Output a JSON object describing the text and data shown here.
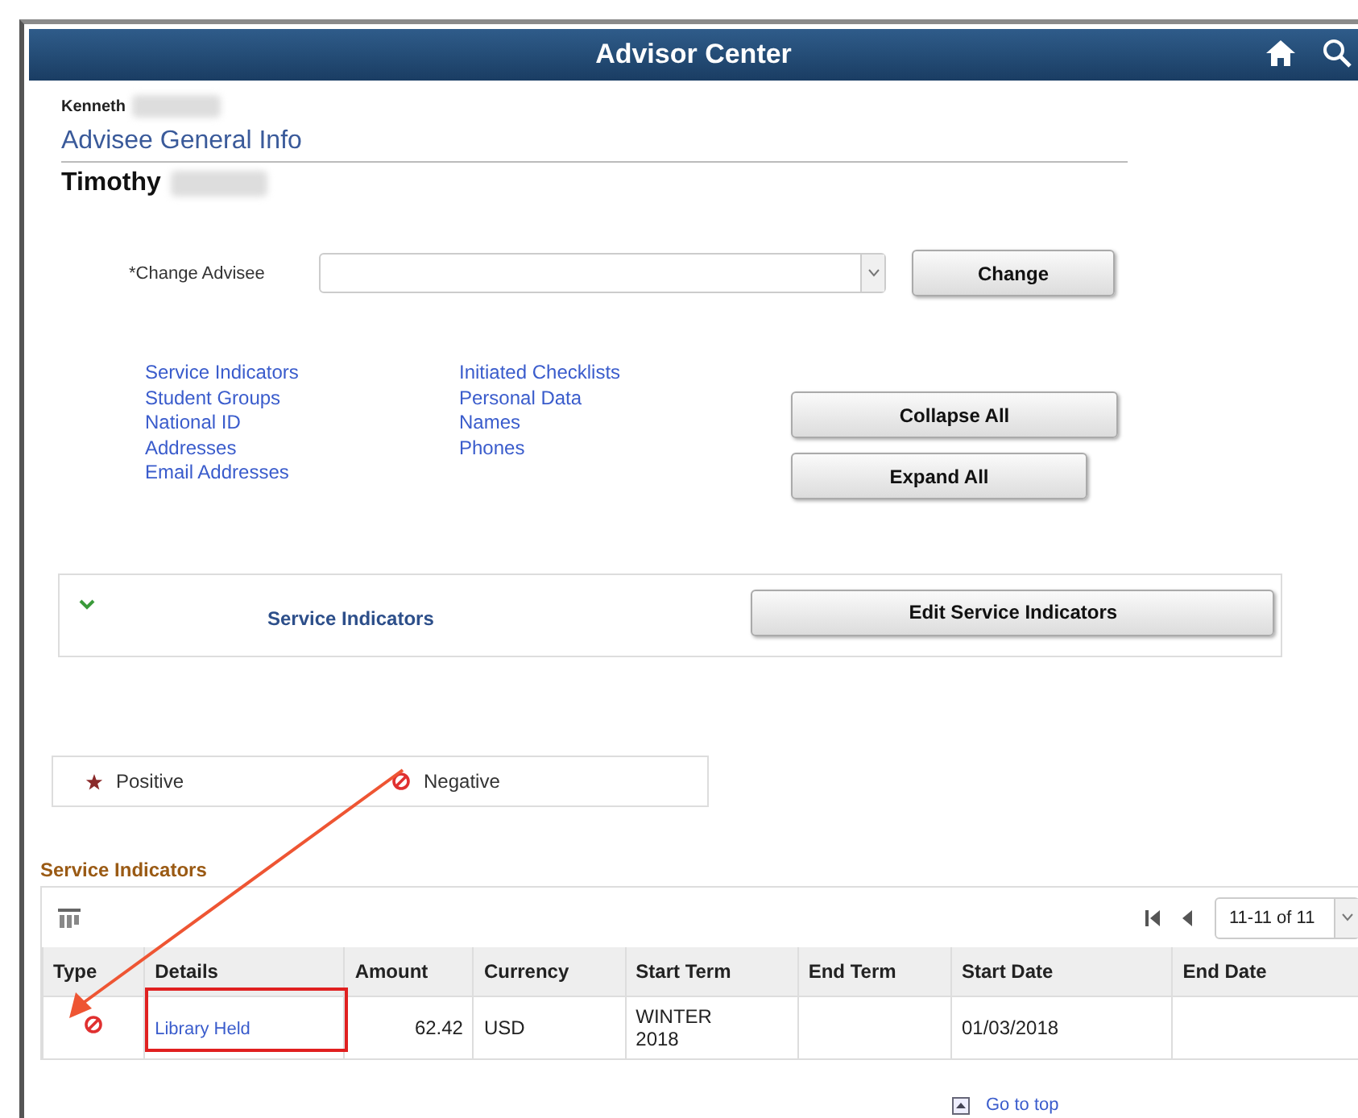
{
  "header": {
    "title": "Advisor Center"
  },
  "advisor": {
    "first_name": "Kenneth"
  },
  "section_title": "Advisee General Info",
  "advisee": {
    "first_name": "Timothy"
  },
  "change_advisee": {
    "label": "*Change Advisee",
    "button": "Change"
  },
  "quick_links": [
    [
      "Service Indicators",
      "Student Groups",
      "National ID",
      "Addresses",
      "Email Addresses"
    ],
    [
      "Initiated Checklists",
      "Personal Data",
      "Names",
      "Phones"
    ]
  ],
  "collapse_button": "Collapse All",
  "expand_button": "Expand All",
  "panel": {
    "title": "Service Indicators",
    "expanded": true,
    "button": "Edit Service Indicators"
  },
  "legend": [
    {
      "kind": "positive",
      "label": "Positive"
    },
    {
      "kind": "negative",
      "label": "Negative"
    }
  ],
  "grid": {
    "title": "Service Indicators",
    "pager": "11-11 of 11",
    "columns": [
      "Type",
      "Details",
      "Amount",
      "Currency",
      "Start Term",
      "End Term",
      "Start Date",
      "End Date"
    ],
    "rows": [
      {
        "kind": "negative",
        "details": "Library Held",
        "amount": "62.42",
        "currency": "USD",
        "start_term": "WINTER 2018",
        "start_date": "01/03/2018"
      }
    ]
  },
  "go_to_top": "Go to top"
}
